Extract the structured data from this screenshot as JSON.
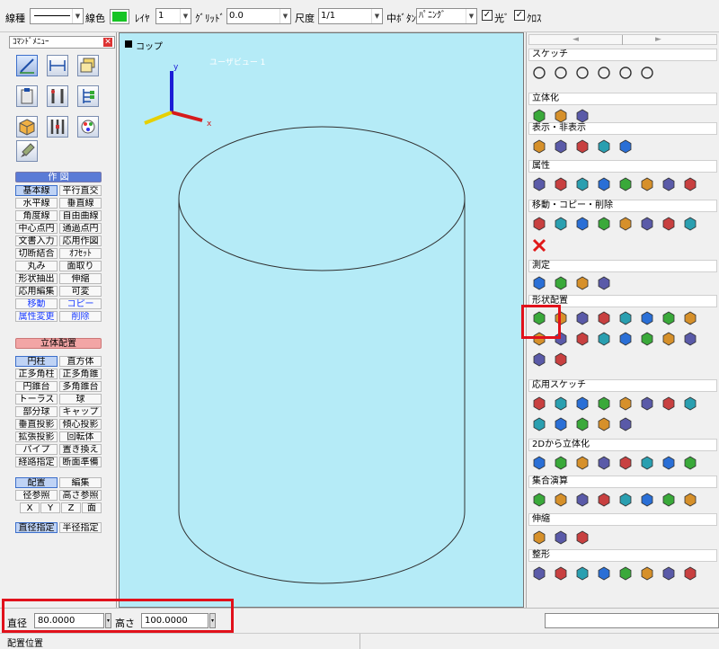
{
  "toolbar": {
    "line_type_label": "線種",
    "line_color_label": "線色",
    "layer_label": "ﾚｲﾔ",
    "layer_value": "1",
    "grid_label": "ｸﾞﾘｯﾄﾞ",
    "grid_value": "0.0",
    "scale_label": "尺度",
    "scale_value": "1/1",
    "middle_button_label": "中ﾎﾞﾀﾝ",
    "middle_button_value": "ﾊﾟﾆﾝｸﾞ",
    "light_label": "光ﾞ",
    "light_checked": true,
    "cross_label": "ｸﾛｽ",
    "cross_checked": true,
    "line_color_swatch": "#16c424"
  },
  "command_menu": {
    "title": "ｺﾏﾝﾄﾞﾒﾆｭｰ",
    "close": "✕",
    "drawing_header": "作 図",
    "drawing_buttons": [
      [
        "基本線",
        "平行直交"
      ],
      [
        "水平線",
        "垂直線"
      ],
      [
        "角度線",
        "自由曲線"
      ],
      [
        "中心点円",
        "通過点円"
      ],
      [
        "文書入力",
        "応用作図"
      ],
      [
        "切断結合",
        "ｵﾌｾｯﾄ"
      ],
      [
        "丸み",
        "面取り"
      ],
      [
        "形状抽出",
        "伸縮"
      ],
      [
        "応用編集",
        "可変"
      ],
      [
        "移動",
        "コピー"
      ],
      [
        "属性変更",
        "削除"
      ]
    ],
    "solid_header": "立体配置",
    "solid_buttons": [
      [
        "円柱",
        "直方体"
      ],
      [
        "正多角柱",
        "正多角錐"
      ],
      [
        "円錐台",
        "多角錐台"
      ],
      [
        "トーラス",
        "球"
      ],
      [
        "部分球",
        "キャップ"
      ],
      [
        "垂直投影",
        "傾心投影"
      ],
      [
        "拡張投影",
        "回転体"
      ],
      [
        "パイプ",
        "置き換え"
      ],
      [
        "経路指定",
        "断面準備"
      ]
    ],
    "place_buttons": [
      "配置",
      "編集"
    ],
    "ref_buttons": [
      "径参照",
      "高さ参照"
    ],
    "axis_buttons": [
      "X",
      "Y",
      "Z",
      "面"
    ],
    "dia_buttons": [
      "直径指定",
      "半径指定"
    ]
  },
  "viewport": {
    "title": "コップ",
    "view_label": "ユーザビュー 1",
    "axis_x": "x",
    "axis_y": "y"
  },
  "palette": {
    "nav_left": "◄",
    "nav_right": "►",
    "sections": [
      "スケッチ",
      "立体化",
      "表示・非表示",
      "属性",
      "移動・コピー・削除",
      "測定",
      "形状配置",
      "応用スケッチ",
      "2Dから立体化",
      "集合演算",
      "伸縮",
      "整形"
    ]
  },
  "bottom": {
    "diameter_label": "直径",
    "diameter_value": "80.0000",
    "height_label": "高さ",
    "height_value": "100.0000"
  },
  "status": {
    "text": "配置位置"
  }
}
